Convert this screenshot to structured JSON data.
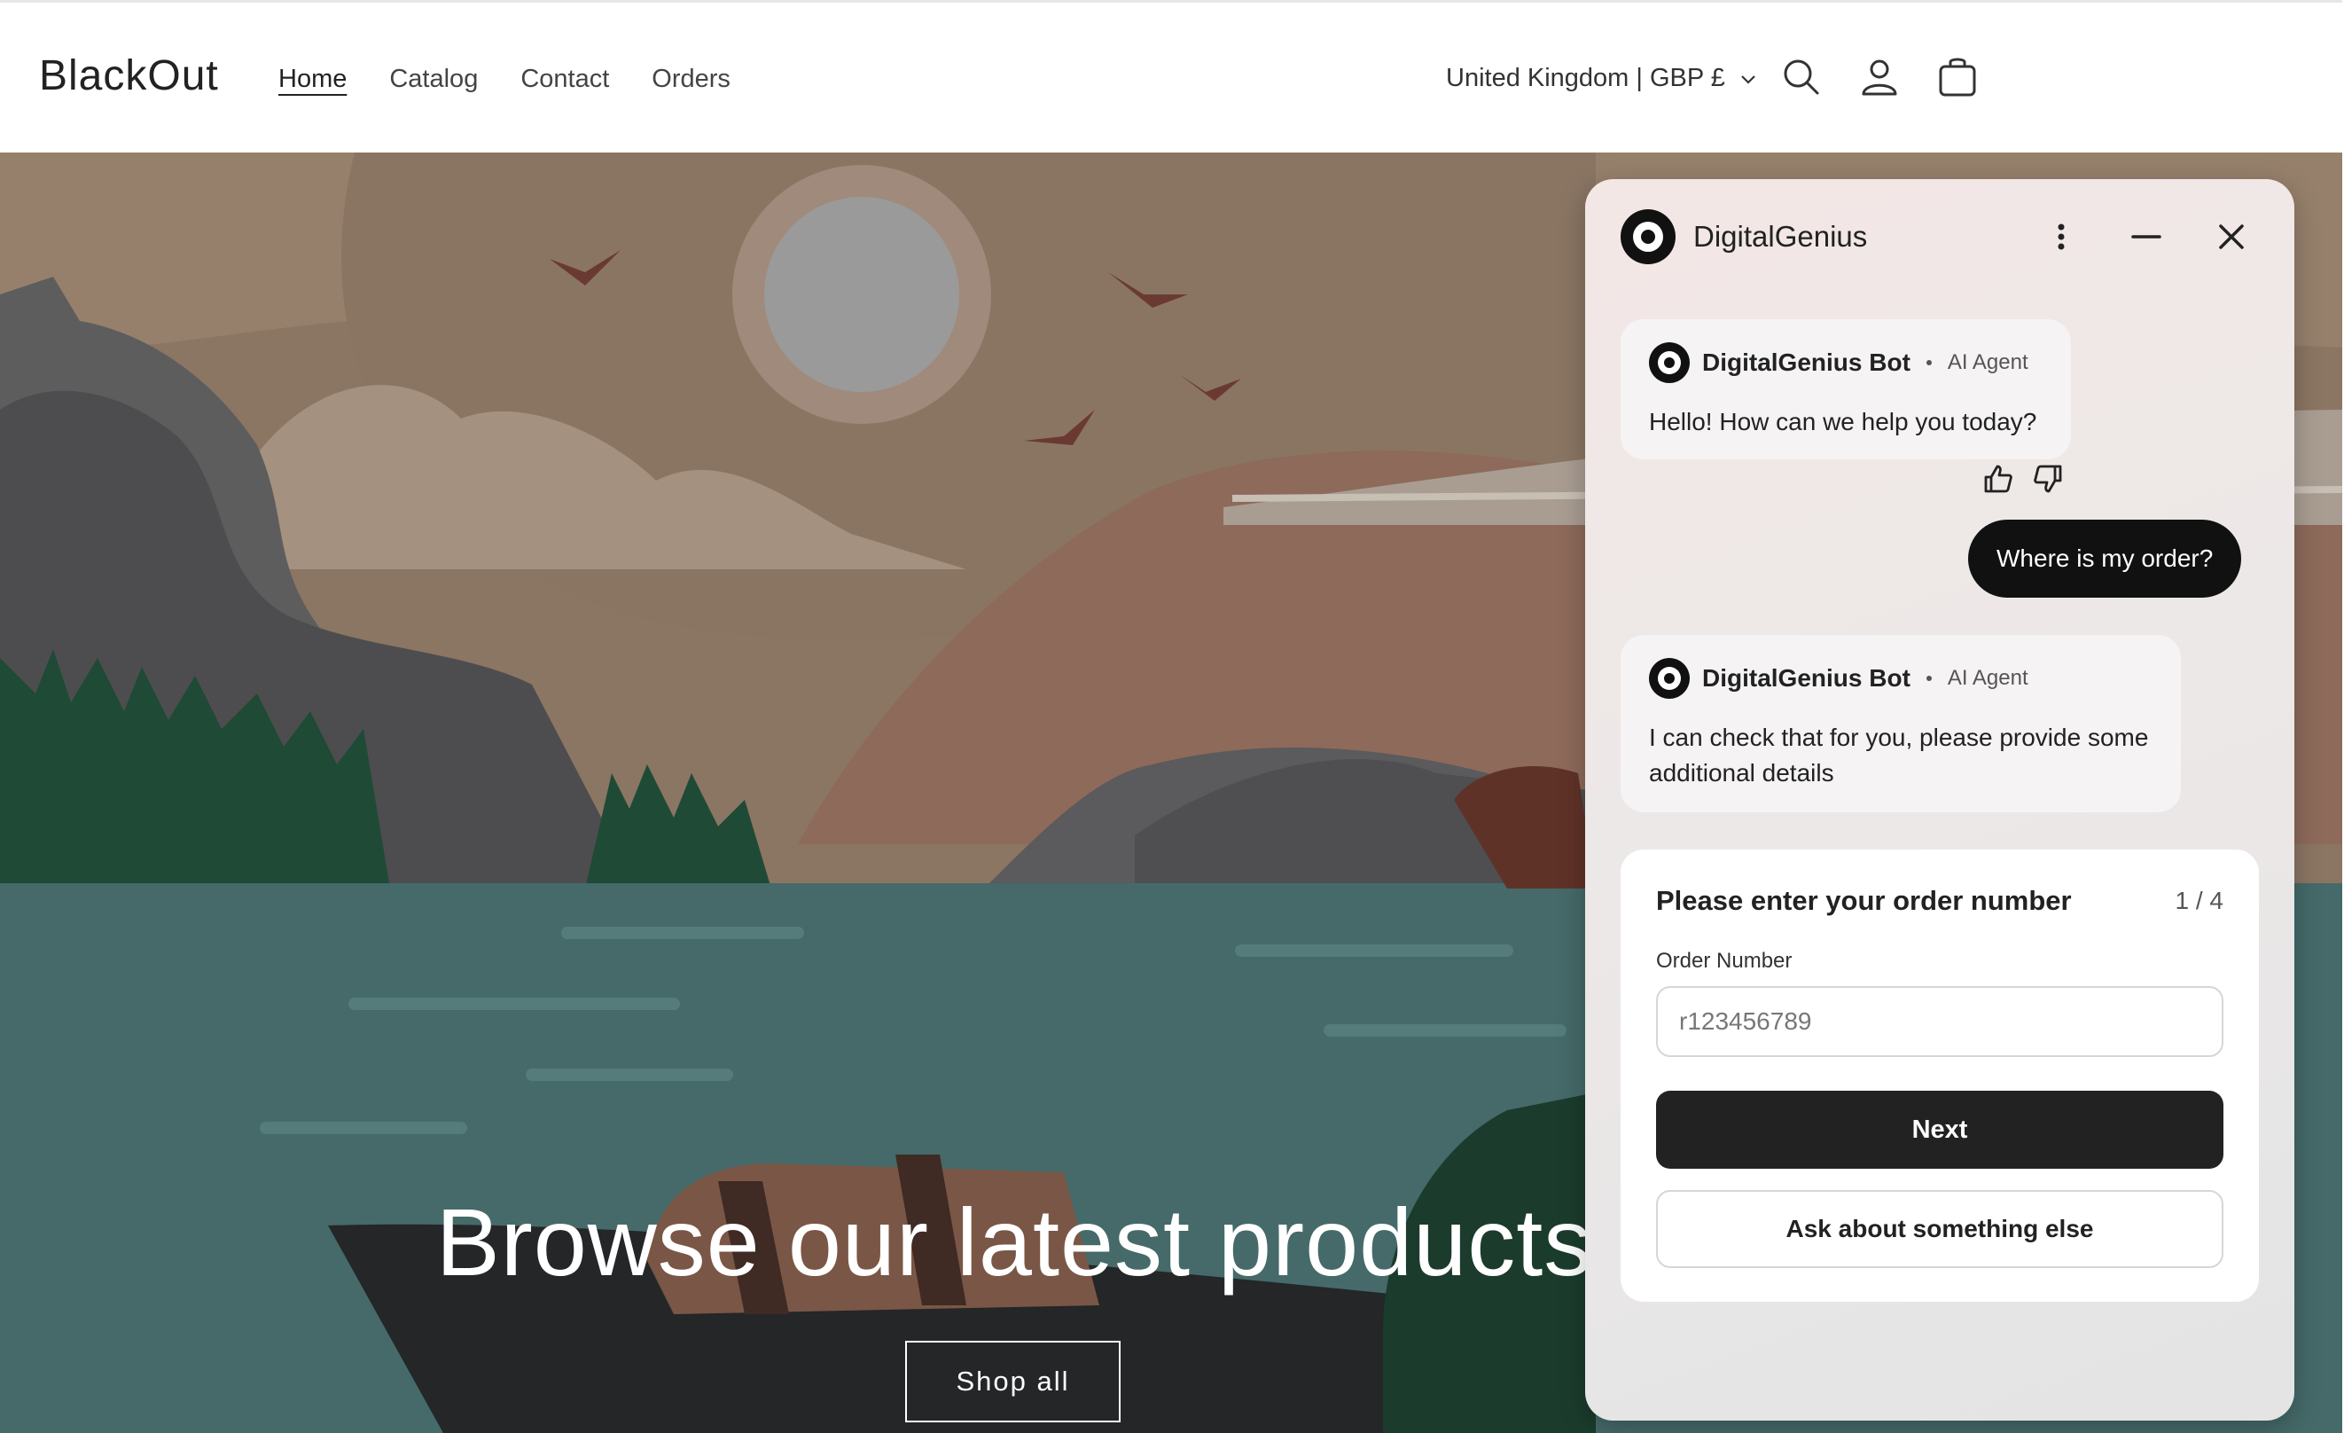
{
  "store": {
    "logo": "BlackOut",
    "nav": [
      "Home",
      "Catalog",
      "Contact",
      "Orders"
    ],
    "country_selector": "United Kingdom | GBP £"
  },
  "hero": {
    "title": "Browse our latest products",
    "button": "Shop all"
  },
  "chat": {
    "title": "DigitalGenius",
    "messages": [
      {
        "sender": "DigitalGenius Bot",
        "tag": "AI Agent",
        "text": "Hello! How can we help you today?"
      },
      {
        "sender": "user",
        "text": "Where is my order?"
      },
      {
        "sender": "DigitalGenius Bot",
        "tag": "AI Agent",
        "text": "I can check that for you, please provide some additional details"
      }
    ],
    "form": {
      "title": "Please enter your order number",
      "step": "1 / 4",
      "label": "Order Number",
      "placeholder": "r123456789",
      "next": "Next",
      "other": "Ask about something else"
    }
  },
  "icons": [
    "search-icon",
    "account-icon",
    "cart-icon",
    "chevron-down-icon",
    "more-vertical-icon",
    "minimize-icon",
    "close-icon",
    "thumbs-up-icon",
    "thumbs-down-icon",
    "digitalgenius-logo-icon"
  ],
  "colors": {
    "accent": "#111111",
    "hero_sky": "#8a7662",
    "hero_water": "#456868"
  }
}
